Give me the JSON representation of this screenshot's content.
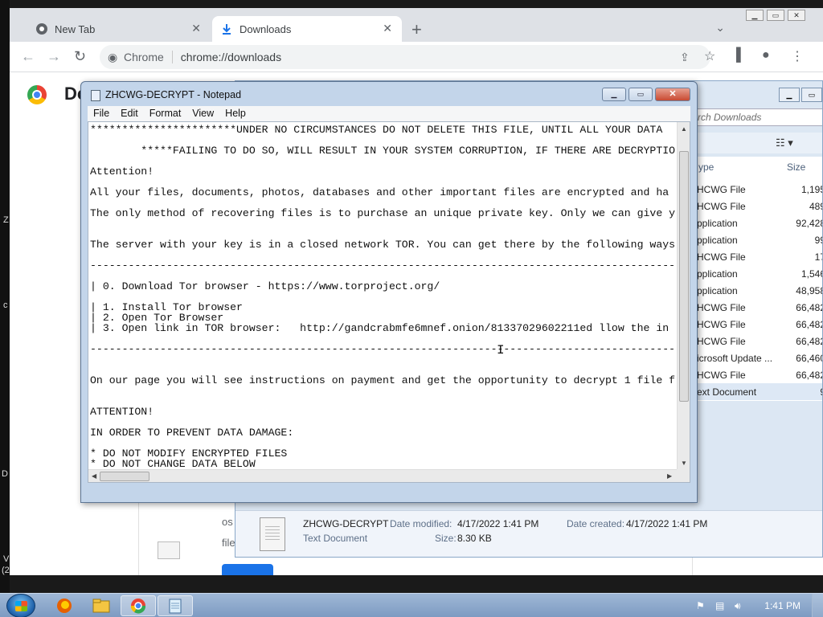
{
  "desktop": {
    "edge_letters": [
      "Z",
      "c",
      "D",
      "V",
      "(2"
    ]
  },
  "chrome": {
    "tabs": [
      {
        "label": "New Tab"
      },
      {
        "label": "Downloads"
      }
    ],
    "omnibox": {
      "site": "Chrome",
      "url": "chrome://downloads"
    },
    "page_title": "Do",
    "card_partial_1": "os",
    "card_partial_2": "file"
  },
  "explorer": {
    "search_placeholder": "rch Downloads",
    "columns": {
      "type": "ype",
      "size": "Size"
    },
    "rows": [
      {
        "type": "HCWG File",
        "size": "1,195"
      },
      {
        "type": "HCWG File",
        "size": "489"
      },
      {
        "type": "pplication",
        "size": "92,428"
      },
      {
        "type": "pplication",
        "size": "99"
      },
      {
        "type": "HCWG File",
        "size": "17"
      },
      {
        "type": "pplication",
        "size": "1,546"
      },
      {
        "type": "pplication",
        "size": "48,958"
      },
      {
        "type": "HCWG File",
        "size": "66,482"
      },
      {
        "type": "HCWG File",
        "size": "66,482"
      },
      {
        "type": "HCWG File",
        "size": "66,482"
      },
      {
        "type": "icrosoft Update ...",
        "size": "66,460"
      },
      {
        "type": "HCWG File",
        "size": "66,482"
      },
      {
        "type": "ext Document",
        "size": "9"
      }
    ],
    "details": {
      "filename": "ZHCWG-DECRYPT",
      "filetype": "Text Document",
      "modified_label": "Date modified:",
      "modified_value": "4/17/2022 1:41 PM",
      "created_label": "Date created:",
      "created_value": "4/17/2022 1:41 PM",
      "size_label": "Size:",
      "size_value": "8.30 KB"
    }
  },
  "notepad": {
    "title": "ZHCWG-DECRYPT - Notepad",
    "menu": [
      "File",
      "Edit",
      "Format",
      "View",
      "Help"
    ],
    "lines": [
      "***********************UNDER NO CIRCUMSTANCES DO NOT DELETE THIS FILE, UNTIL ALL YOUR DATA",
      "        *****FAILING TO DO SO, WILL RESULT IN YOUR SYSTEM CORRUPTION, IF THERE ARE DECRYPTIO",
      "Attention!",
      "All your files, documents, photos, databases and other important files are encrypted and ha",
      "The only method of recovering files is to purchase an unique private key. Only we can give y",
      "The server with your key is in a closed network TOR. You can get there by the following ways",
      "---------------------------------------------------------------------------------------------",
      "| 0. Download Tor browser - https://www.torproject.org/",
      "| 1. Install Tor browser",
      "| 2. Open Tor Browser",
      "| 3. Open link in TOR browser:   http://gandcrabmfe6mnef.onion/81337029602211ed llow the in",
      "---------------------------------------------------------------------------------------------",
      "On our page you will see instructions on payment and get the opportunity to decrypt 1 file f",
      "ATTENTION!",
      "IN ORDER TO PREVENT DATA DAMAGE:",
      "* DO NOT MODIFY ENCRYPTED FILES",
      "* DO NOT CHANGE DATA BELOW"
    ]
  },
  "taskbar": {
    "clock": "1:41 PM"
  }
}
